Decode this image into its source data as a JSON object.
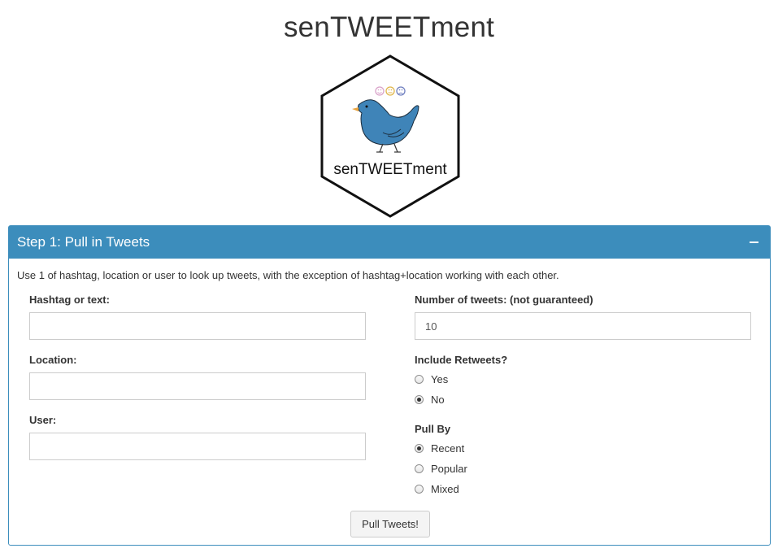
{
  "app": {
    "title": "senTWEETment"
  },
  "logo": {
    "text": "senTWEETment",
    "face_icons": [
      "smile-face-icon",
      "neutral-face-icon",
      "sad-face-icon"
    ],
    "bird_color": "#3f84b8"
  },
  "panel": {
    "title": "Step 1: Pull in Tweets",
    "collapse_icon": "minus-icon",
    "intro": "Use 1 of hashtag, location or user to look up tweets, with the exception of hashtag+location working with each other.",
    "header_color": "#3c8dbc"
  },
  "form": {
    "hashtag": {
      "label": "Hashtag or text:",
      "value": "",
      "placeholder": ""
    },
    "location": {
      "label": "Location:",
      "value": "",
      "placeholder": ""
    },
    "user": {
      "label": "User:",
      "value": "",
      "placeholder": ""
    },
    "num_tweets": {
      "label": "Number of tweets: (not guaranteed)",
      "value": "10"
    },
    "retweets": {
      "label": "Include Retweets?",
      "options": [
        {
          "label": "Yes",
          "checked": false
        },
        {
          "label": "No",
          "checked": true
        }
      ]
    },
    "pull_by": {
      "label": "Pull By",
      "options": [
        {
          "label": "Recent",
          "checked": true
        },
        {
          "label": "Popular",
          "checked": false
        },
        {
          "label": "Mixed",
          "checked": false
        }
      ]
    },
    "submit_label": "Pull Tweets!"
  }
}
